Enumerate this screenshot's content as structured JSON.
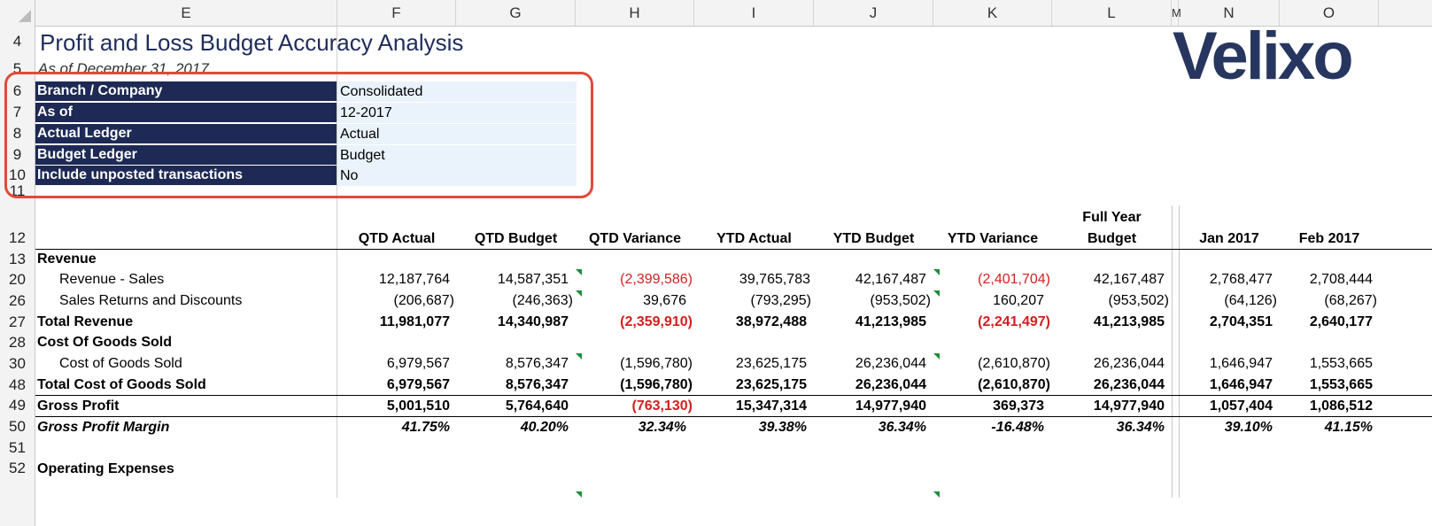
{
  "columns": [
    "E",
    "F",
    "G",
    "H",
    "I",
    "J",
    "K",
    "L",
    "M",
    "N",
    "O"
  ],
  "rows": [
    "4",
    "5",
    "6",
    "7",
    "8",
    "9",
    "10",
    "11",
    "12",
    "13",
    "20",
    "26",
    "27",
    "28",
    "30",
    "48",
    "49",
    "50",
    "51",
    "52"
  ],
  "title": "Profit and Loss Budget Accuracy Analysis",
  "subtitle": "As of December 31, 2017",
  "logo_text": "Velixo",
  "params": [
    {
      "label": "Branch / Company",
      "value": "Consolidated"
    },
    {
      "label": "As of",
      "value": "12-2017"
    },
    {
      "label": "Actual Ledger",
      "value": "Actual"
    },
    {
      "label": "Budget Ledger",
      "value": "Budget"
    },
    {
      "label": "Include unposted transactions",
      "value": "No"
    }
  ],
  "headers": {
    "f": "QTD Actual",
    "g": "QTD Budget",
    "h": "QTD Variance",
    "i": "YTD Actual",
    "j": "YTD Budget",
    "k": "YTD Variance",
    "l_top": "Full Year",
    "l_bottom": "Budget",
    "n": "Jan 2017",
    "o": "Feb 2017"
  },
  "lines": [
    {
      "label": "Revenue",
      "vals": [
        "",
        "",
        "",
        "",
        "",
        "",
        "",
        "",
        ""
      ]
    },
    {
      "label": "Revenue - Sales",
      "vals": [
        "12,187,764",
        "14,587,351",
        "(2,399,586)",
        "39,765,783",
        "42,167,487",
        "(2,401,704)",
        "42,167,487",
        "2,768,477",
        "2,708,444"
      ]
    },
    {
      "label": "Sales Returns and Discounts",
      "vals": [
        "(206,687)",
        "(246,363)",
        "39,676",
        "(793,295)",
        "(953,502)",
        "160,207",
        "(953,502)",
        "(64,126)",
        "(68,267)"
      ]
    },
    {
      "label": "Total Revenue",
      "vals": [
        "11,981,077",
        "14,340,987",
        "(2,359,910)",
        "38,972,488",
        "41,213,985",
        "(2,241,497)",
        "41,213,985",
        "2,704,351",
        "2,640,177"
      ]
    },
    {
      "label": "Cost Of Goods Sold",
      "vals": [
        "",
        "",
        "",
        "",
        "",
        "",
        "",
        "",
        ""
      ]
    },
    {
      "label": "Cost of Goods Sold",
      "vals": [
        "6,979,567",
        "8,576,347",
        "(1,596,780)",
        "23,625,175",
        "26,236,044",
        "(2,610,870)",
        "26,236,044",
        "1,646,947",
        "1,553,665"
      ]
    },
    {
      "label": "Total Cost of Goods Sold",
      "vals": [
        "6,979,567",
        "8,576,347",
        "(1,596,780)",
        "23,625,175",
        "26,236,044",
        "(2,610,870)",
        "26,236,044",
        "1,646,947",
        "1,553,665"
      ]
    },
    {
      "label": "Gross Profit",
      "vals": [
        "5,001,510",
        "5,764,640",
        "(763,130)",
        "15,347,314",
        "14,977,940",
        "369,373",
        "14,977,940",
        "1,057,404",
        "1,086,512"
      ]
    },
    {
      "label": "Gross Profit Margin",
      "vals": [
        "41.75%",
        "40.20%",
        "32.34%",
        "39.38%",
        "36.34%",
        "-16.48%",
        "36.34%",
        "39.10%",
        "41.15%"
      ]
    },
    {
      "label": "",
      "vals": [
        "",
        "",
        "",
        "",
        "",
        "",
        "",
        "",
        ""
      ]
    },
    {
      "label": "Operating Expenses",
      "vals": [
        "",
        "",
        "",
        "",
        "",
        "",
        "",
        "",
        ""
      ]
    }
  ],
  "colors": {
    "param_bg": "#1e2a55",
    "param_value_bg": "#eaf3fb",
    "negative": "#d21f1f",
    "highlight_border": "#e04a3a",
    "title": "#1f2d5c"
  }
}
